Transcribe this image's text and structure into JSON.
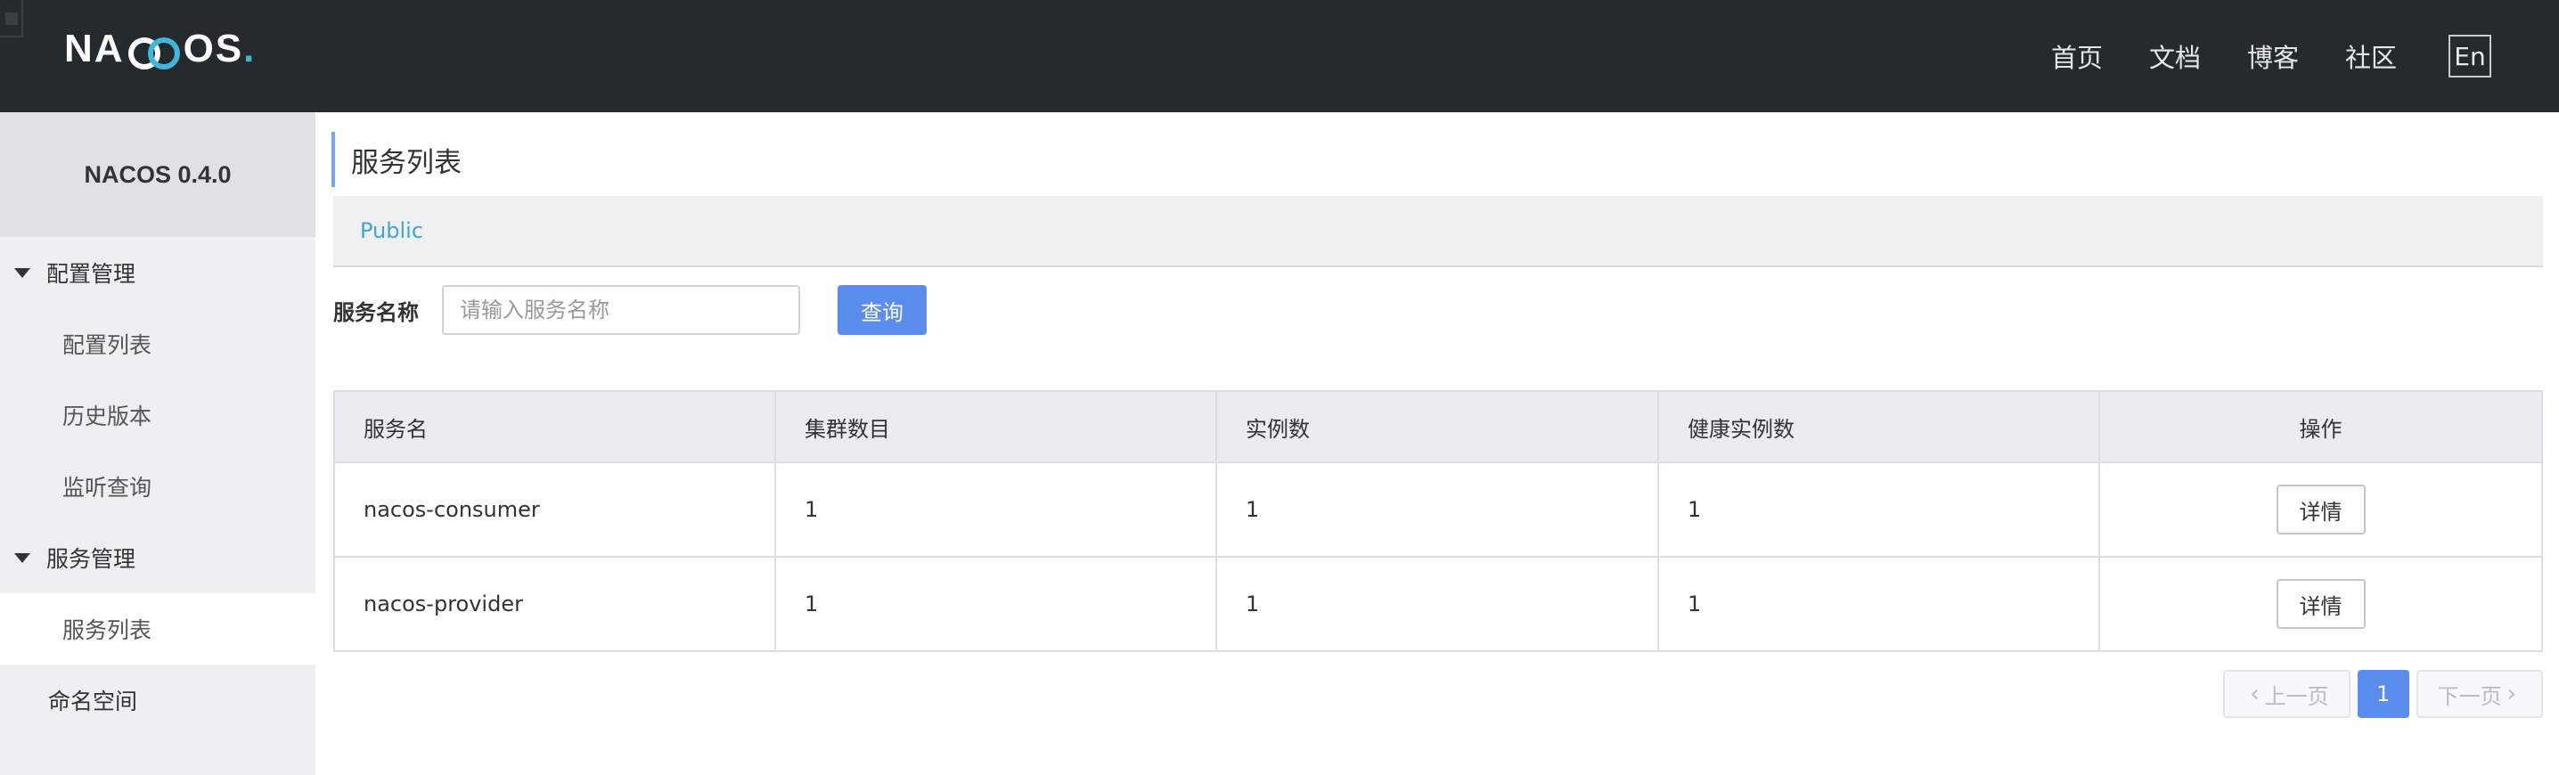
{
  "header": {
    "logo_text": "NACOS.",
    "nav": [
      "首页",
      "文档",
      "博客",
      "社区"
    ],
    "lang_button": "En"
  },
  "sidebar": {
    "version": "NACOS 0.4.0",
    "groups": [
      {
        "label": "配置管理",
        "items": [
          "配置列表",
          "历史版本",
          "监听查询"
        ]
      },
      {
        "label": "服务管理",
        "items": [
          "服务列表"
        ]
      }
    ],
    "namespace_item": "命名空间",
    "active_item": "服务列表"
  },
  "main": {
    "title": "服务列表",
    "namespace": "Public",
    "search": {
      "label": "服务名称",
      "placeholder": "请输入服务名称",
      "value": "",
      "button": "查询"
    },
    "table": {
      "headers": [
        "服务名",
        "集群数目",
        "实例数",
        "健康实例数",
        "操作"
      ],
      "rows": [
        {
          "name": "nacos-consumer",
          "clusters": "1",
          "instances": "1",
          "healthy": "1",
          "action": "详情"
        },
        {
          "name": "nacos-provider",
          "clusters": "1",
          "instances": "1",
          "healthy": "1",
          "action": "详情"
        }
      ]
    },
    "pagination": {
      "prev": "上一页",
      "current": "1",
      "next": "下一页"
    }
  },
  "colors": {
    "header_bg": "#252a2f",
    "accent": "#5b8def",
    "namespace_link": "#3fa7d8"
  }
}
